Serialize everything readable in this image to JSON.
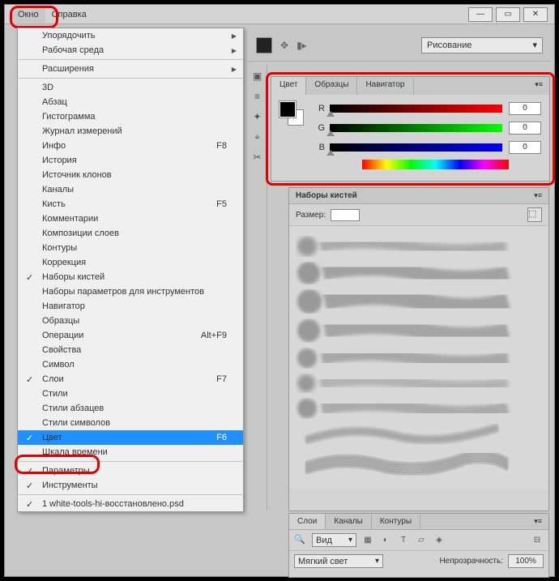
{
  "menubar": {
    "window": "Окно",
    "help": "Справка"
  },
  "optionsbar": {
    "dropdown": "Рисование"
  },
  "dropdown": {
    "items": [
      {
        "label": "Упорядочить",
        "arrow": true
      },
      {
        "label": "Рабочая среда",
        "arrow": true
      },
      null,
      {
        "label": "Расширения",
        "arrow": true,
        "disabled": true
      },
      null,
      {
        "label": "3D"
      },
      {
        "label": "Абзац"
      },
      {
        "label": "Гистограмма"
      },
      {
        "label": "Журнал измерений"
      },
      {
        "label": "Инфо",
        "short": "F8"
      },
      {
        "label": "История"
      },
      {
        "label": "Источник клонов"
      },
      {
        "label": "Каналы"
      },
      {
        "label": "Кисть",
        "short": "F5"
      },
      {
        "label": "Комментарии"
      },
      {
        "label": "Композиции слоев"
      },
      {
        "label": "Контуры"
      },
      {
        "label": "Коррекция"
      },
      {
        "label": "Наборы кистей",
        "check": true
      },
      {
        "label": "Наборы параметров для инструментов"
      },
      {
        "label": "Навигатор"
      },
      {
        "label": "Образцы"
      },
      {
        "label": "Операции",
        "short": "Alt+F9"
      },
      {
        "label": "Свойства"
      },
      {
        "label": "Символ"
      },
      {
        "label": "Слои",
        "short": "F7",
        "check": true
      },
      {
        "label": "Стили"
      },
      {
        "label": "Стили абзацев"
      },
      {
        "label": "Стили символов"
      },
      {
        "label": "Цвет",
        "short": "F6",
        "check": true,
        "selected": true
      },
      {
        "label": "Шкала времени"
      },
      null,
      {
        "label": "Параметры",
        "check": true
      },
      {
        "label": "Инструменты",
        "check": true
      },
      null,
      {
        "label": "1 white-tools-hi-восстановлено.psd",
        "check": true
      }
    ]
  },
  "colorpanel": {
    "tabs": [
      "Цвет",
      "Образцы",
      "Навигатор"
    ],
    "r": {
      "label": "R",
      "value": "0"
    },
    "g": {
      "label": "G",
      "value": "0"
    },
    "b": {
      "label": "B",
      "value": "0"
    }
  },
  "brushpanel": {
    "title": "Наборы кистей",
    "size_label": "Размер:"
  },
  "layerspanel": {
    "tabs": [
      "Слои",
      "Каналы",
      "Контуры"
    ],
    "kind": "Вид",
    "blend": "Мягкий свет",
    "opacity_label": "Непрозрачность:",
    "opacity_value": "100%"
  }
}
